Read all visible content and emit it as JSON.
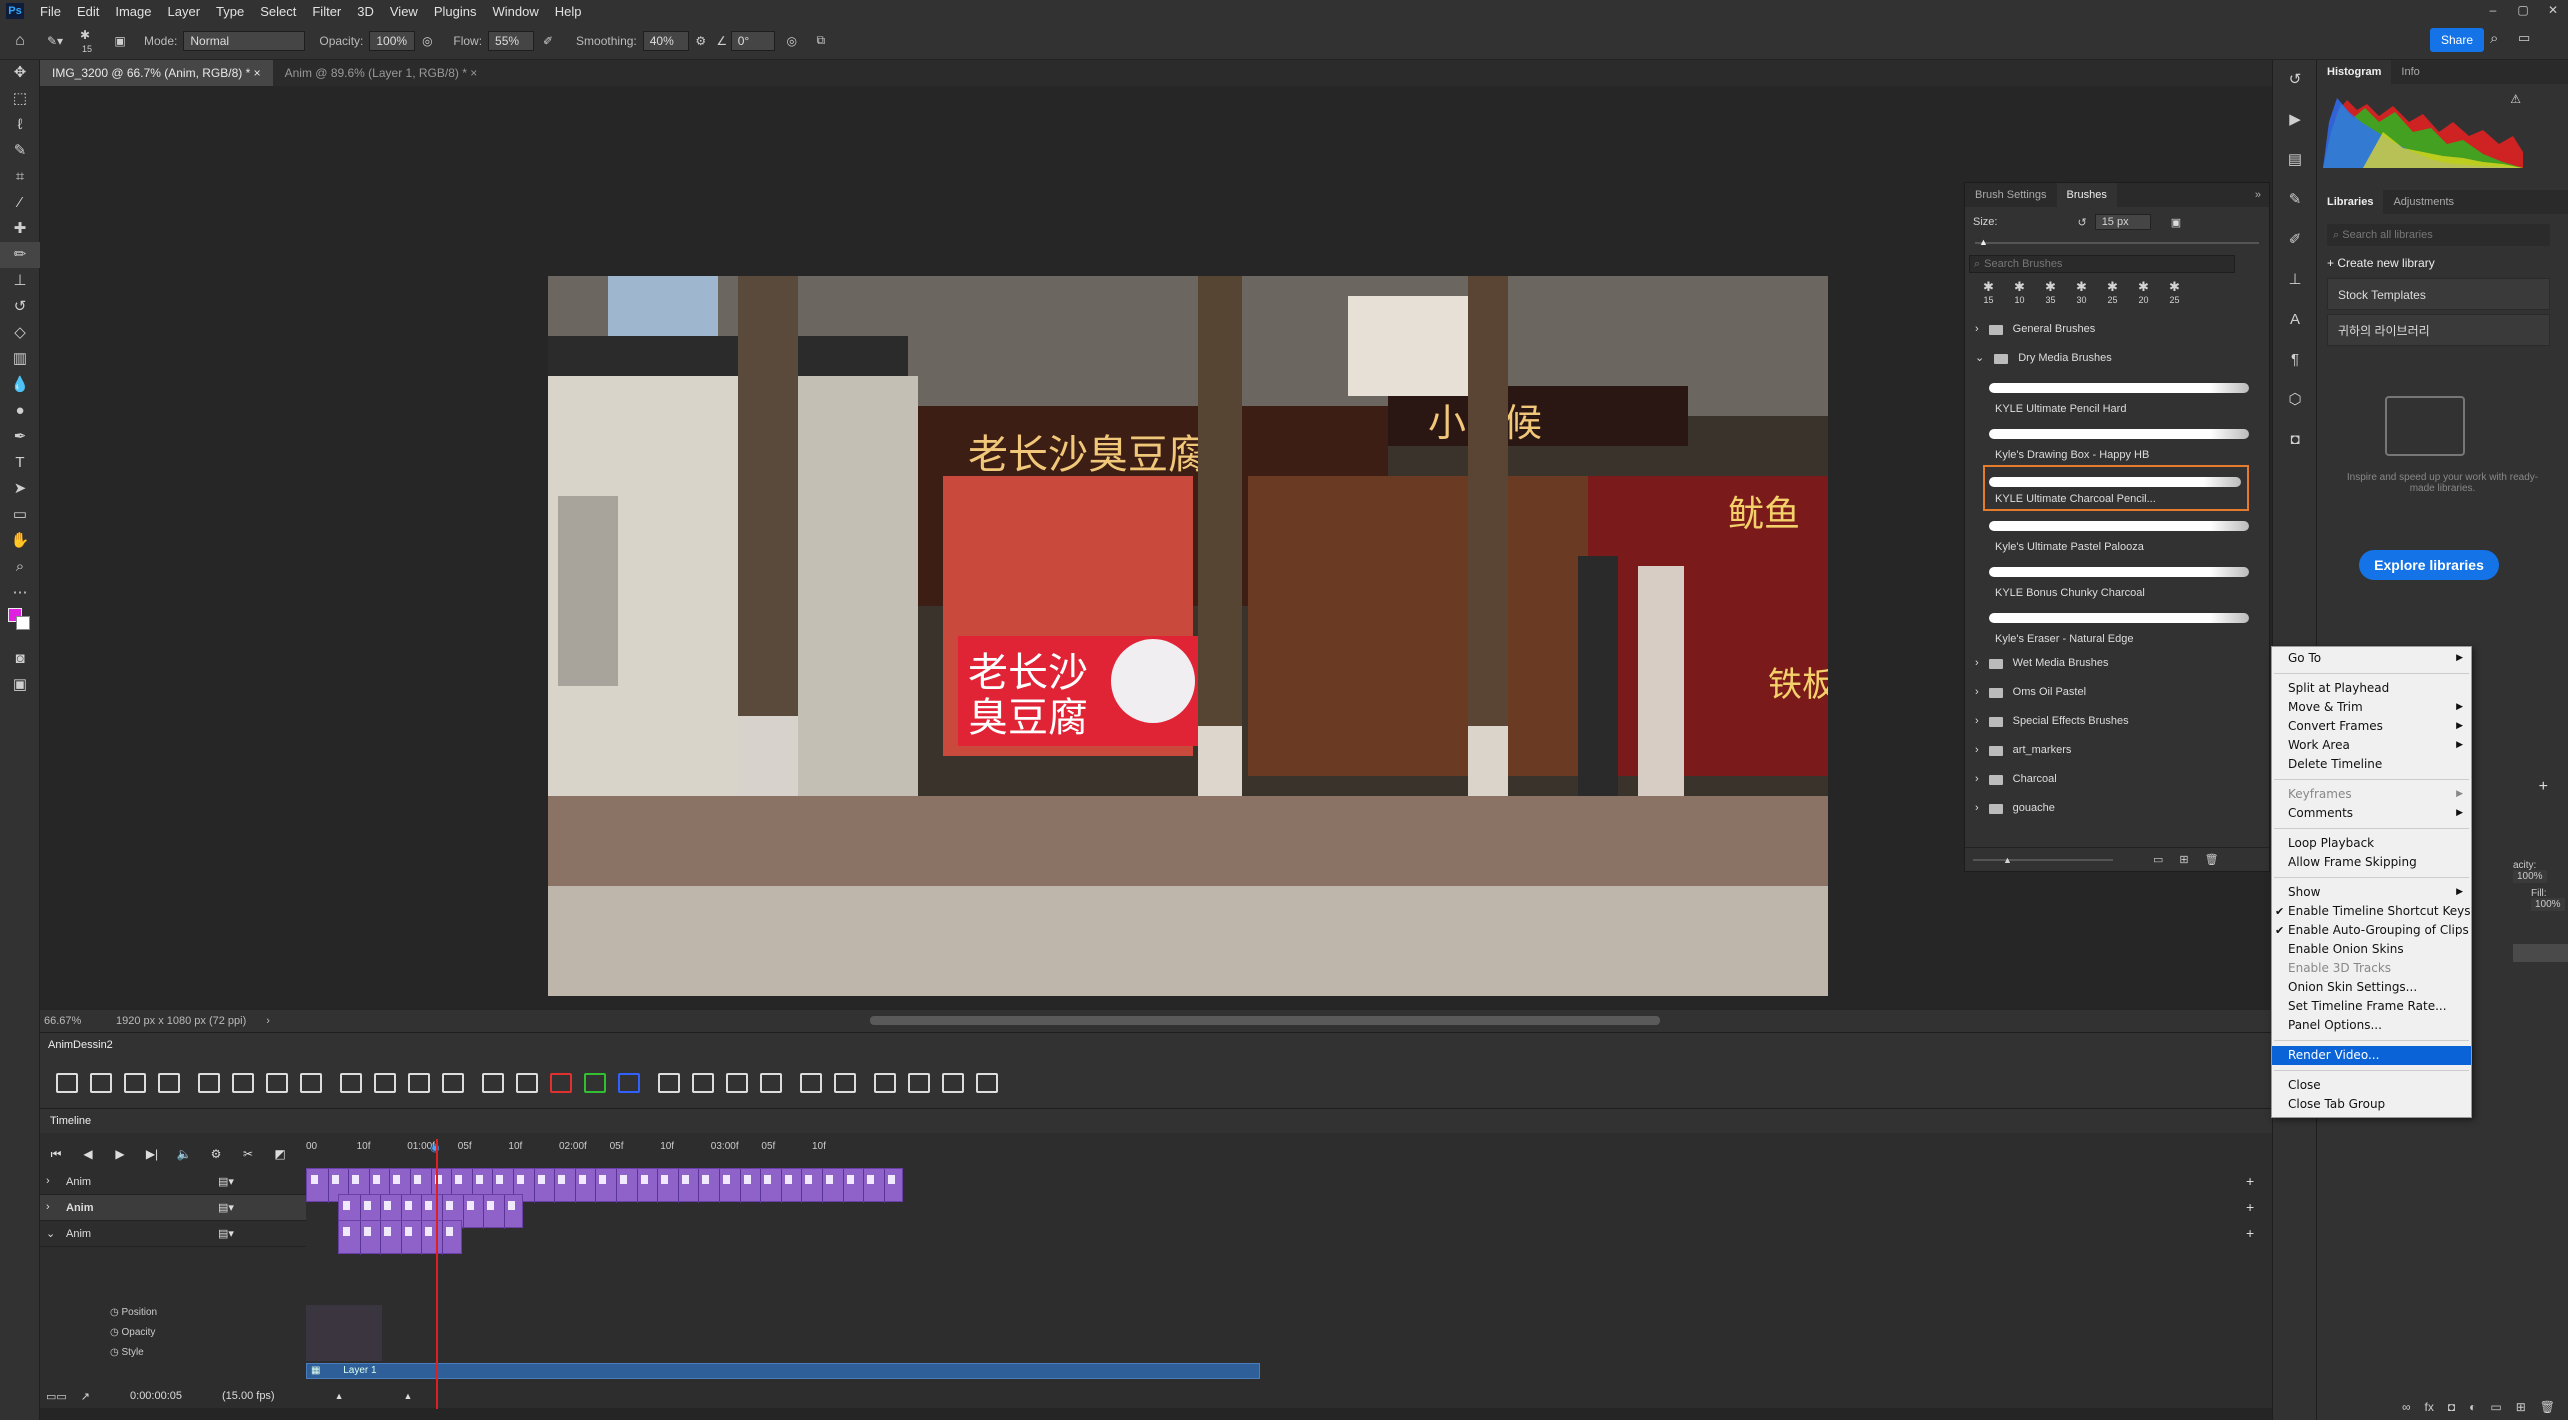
{
  "app": {
    "logo": "Ps"
  },
  "menu": [
    "File",
    "Edit",
    "Image",
    "Layer",
    "Type",
    "Select",
    "Filter",
    "3D",
    "View",
    "Plugins",
    "Window",
    "Help"
  ],
  "options": {
    "brush_size": "15",
    "mode_label": "Mode:",
    "mode_value": "Normal",
    "opacity_label": "Opacity:",
    "opacity_value": "100%",
    "flow_label": "Flow:",
    "flow_value": "55%",
    "smoothing_label": "Smoothing:",
    "smoothing_value": "40%",
    "angle_value": "0°",
    "share_label": "Share"
  },
  "doc_tabs": [
    {
      "label": "IMG_3200 @ 66.7% (Anim, RGB/8) *",
      "active": true
    },
    {
      "label": "Anim @ 89.6% (Layer 1, RGB/8) *",
      "active": false
    }
  ],
  "status": {
    "zoom": "66.67%",
    "info": "1920 px x 1080 px (72 ppi)"
  },
  "photo_signs": {
    "main_sign": "老长沙臭豆腐",
    "stall_sign_1": "老长沙",
    "stall_sign_2": "臭豆腐",
    "right_sign": "小时候",
    "red_sign": "鱿鱼",
    "bottom_sign": "铁板"
  },
  "brushes": {
    "tabs": [
      "Brush Settings",
      "Brushes"
    ],
    "size_label": "Size:",
    "size_value": "15 px",
    "search_placeholder": "Search Brushes",
    "preset_sizes": [
      "15",
      "10",
      "35",
      "30",
      "25",
      "20",
      "25"
    ],
    "folders_top": [
      "General Brushes",
      "Dry Media Brushes"
    ],
    "items": [
      {
        "name": "KYLE Ultimate Pencil Hard",
        "selected": false
      },
      {
        "name": "Kyle's Drawing Box - Happy HB",
        "selected": false
      },
      {
        "name": "KYLE Ultimate Charcoal Pencil...",
        "selected": true
      },
      {
        "name": "Kyle's Ultimate Pastel Palooza",
        "selected": false
      },
      {
        "name": "KYLE Bonus Chunky Charcoal",
        "selected": false
      },
      {
        "name": "Kyle's Eraser - Natural Edge",
        "selected": false
      }
    ],
    "folders_bottom": [
      "Wet Media Brushes",
      "Oms Oil Pastel",
      "Special Effects Brushes",
      "art_markers",
      "Charcoal",
      "gouache"
    ]
  },
  "right_panel": {
    "tabs_top": [
      "Histogram",
      "Info"
    ],
    "tabs_lib": [
      "Libraries",
      "Adjustments"
    ],
    "search_placeholder": "Search all libraries",
    "create_label": "Create new library",
    "libs": [
      "Stock Templates",
      "귀하의 라이브러리"
    ],
    "hint": "Inspire and speed up your work with ready-made libraries.",
    "explore_label": "Explore libraries",
    "opacity_label": "acity:",
    "opacity_value": "100%",
    "fill_label": "Fill:",
    "fill_value": "100%"
  },
  "context_menu": {
    "groups": [
      [
        {
          "label": "Go To",
          "sub": true
        }
      ],
      [
        {
          "label": "Split at Playhead"
        },
        {
          "label": "Move & Trim",
          "sub": true
        },
        {
          "label": "Convert Frames",
          "sub": true
        },
        {
          "label": "Work Area",
          "sub": true
        },
        {
          "label": "Delete Timeline"
        }
      ],
      [
        {
          "label": "Keyframes",
          "sub": true,
          "disabled": true
        },
        {
          "label": "Comments",
          "sub": true
        }
      ],
      [
        {
          "label": "Loop Playback"
        },
        {
          "label": "Allow Frame Skipping"
        }
      ],
      [
        {
          "label": "Show",
          "sub": true
        },
        {
          "label": "Enable Timeline Shortcut Keys",
          "checked": true
        },
        {
          "label": "Enable Auto-Grouping of Clips",
          "checked": true
        },
        {
          "label": "Enable Onion Skins"
        },
        {
          "label": "Enable 3D Tracks",
          "disabled": true
        },
        {
          "label": "Onion Skin Settings..."
        },
        {
          "label": "Set Timeline Frame Rate..."
        },
        {
          "label": "Panel Options..."
        }
      ],
      [
        {
          "label": "Render Video...",
          "highlight": true
        }
      ],
      [
        {
          "label": "Close"
        },
        {
          "label": "Close Tab Group"
        }
      ]
    ]
  },
  "anim_panel": {
    "title": "AnimDessin2",
    "button_count": 27
  },
  "timeline": {
    "title": "Timeline",
    "ruler": [
      "00",
      "10f",
      "01:00f",
      "05f",
      "10f",
      "02:00f",
      "05f",
      "10f",
      "03:00f",
      "05f",
      "10f"
    ],
    "tracks": [
      {
        "label": "Anim",
        "frames": 29
      },
      {
        "label": "Anim",
        "frames": 9
      },
      {
        "label": "Anim",
        "frames": 6
      }
    ],
    "properties": [
      "Position",
      "Opacity",
      "Style"
    ],
    "layer_label": "Layer 1",
    "timecode": "0:00:00:05",
    "fps": "(15.00 fps)"
  },
  "colors": {
    "accent": "#1473e6",
    "clip": "#8e62c8",
    "playhead": "#e02020",
    "fg_swatch": "#e020e0",
    "bg_swatch": "#ffffff"
  }
}
